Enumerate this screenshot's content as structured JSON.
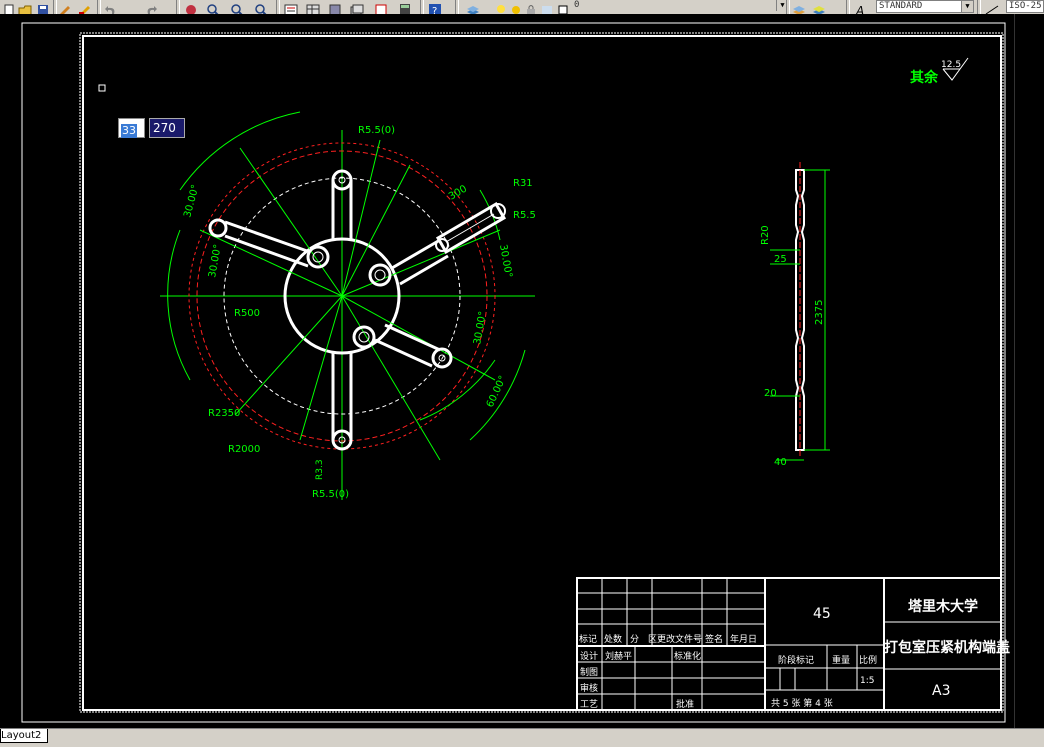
{
  "toolbar": {
    "layer_value": "0",
    "text_style": "STANDARD",
    "dim_style": "ISO-25"
  },
  "dynamic_input": {
    "field1": "33",
    "field2": "270"
  },
  "layout_tab": "Layout2",
  "drawing": {
    "roughness": "其余",
    "roughness_value": "12.5",
    "dims_left": {
      "d1": "R5.5(0)",
      "d2": "30.00°",
      "d3": "30.00°",
      "d4": "R500",
      "d5": "R2350",
      "d6": "R2000",
      "d7": "R3.3",
      "d8": "R5.5(0)",
      "d9": "300",
      "d10": "R31",
      "d11": "R5.5",
      "d12": "30.00°",
      "d13": "30.00°",
      "d14": "60.00°"
    },
    "dims_side": {
      "s1": "R20",
      "s2": "25",
      "s3": "2375",
      "s4": "20",
      "s5": "40"
    }
  },
  "title_block": {
    "material": "45",
    "school": "塔里木大学",
    "part_name": "打包室压紧机构端盖",
    "sheet": "A3",
    "headers": [
      "标记",
      "处数",
      "分",
      "区",
      "更改文件号",
      "签名",
      "年月日"
    ],
    "design_label": "设计",
    "designer": "刘赫平",
    "standardize": "标准化",
    "draw_label": "制图",
    "review_label": "审核",
    "process_label": "工艺",
    "approve": "批准",
    "stage_label": "阶段标记",
    "weight_label": "重量",
    "scale_label": "比例",
    "scale": "1:5",
    "sheets": "共 5 张 第 4 张"
  }
}
